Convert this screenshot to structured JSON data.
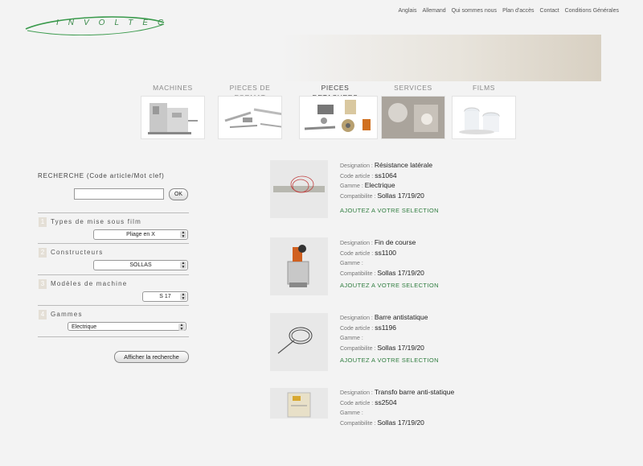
{
  "logo": {
    "text": "INVOLTEC"
  },
  "topnav": [
    "Anglais",
    "Allemand",
    "Qui sommes nous",
    "Plan d'accès",
    "Contact",
    "Conditions Générales"
  ],
  "categories": [
    {
      "label": "MACHINES"
    },
    {
      "label": "PIECES DE FORMAT"
    },
    {
      "label": "PIECES DETACHEES"
    },
    {
      "label": "SERVICES"
    },
    {
      "label": "FILMS"
    }
  ],
  "search": {
    "title": "RECHERCHE (Code article/Mot clef)",
    "input_value": "",
    "ok_label": "OK",
    "filters": [
      {
        "num": "1",
        "label": "Types de mise sous film",
        "selected": "Pliage en X"
      },
      {
        "num": "2",
        "label": "Constructeurs",
        "selected": "SOLLAS"
      },
      {
        "num": "3",
        "label": "Modèles de machine",
        "selected": "S 17"
      },
      {
        "num": "4",
        "label": "Gammes",
        "selected": "Electrique"
      }
    ],
    "show_label": "Afficher la recherche"
  },
  "field_labels": {
    "designation": "Designation :",
    "code": "Code article :",
    "gamme": "Gamme :",
    "compat": "Compatibilite :"
  },
  "add_label": "AJOUTEZ A VOTRE SELECTION",
  "products": [
    {
      "designation": "Résistance latérale",
      "code": "ss1064",
      "gamme": "Electrique",
      "compat": "Sollas 17/19/20"
    },
    {
      "designation": "Fin de course",
      "code": "ss1100",
      "gamme": "",
      "compat": "Sollas 17/19/20"
    },
    {
      "designation": "Barre antistatique",
      "code": "ss1196",
      "gamme": "",
      "compat": "Sollas 17/19/20"
    },
    {
      "designation": "Transfo barre anti-statique",
      "code": "ss2504",
      "gamme": "",
      "compat": "Sollas 17/19/20"
    }
  ]
}
